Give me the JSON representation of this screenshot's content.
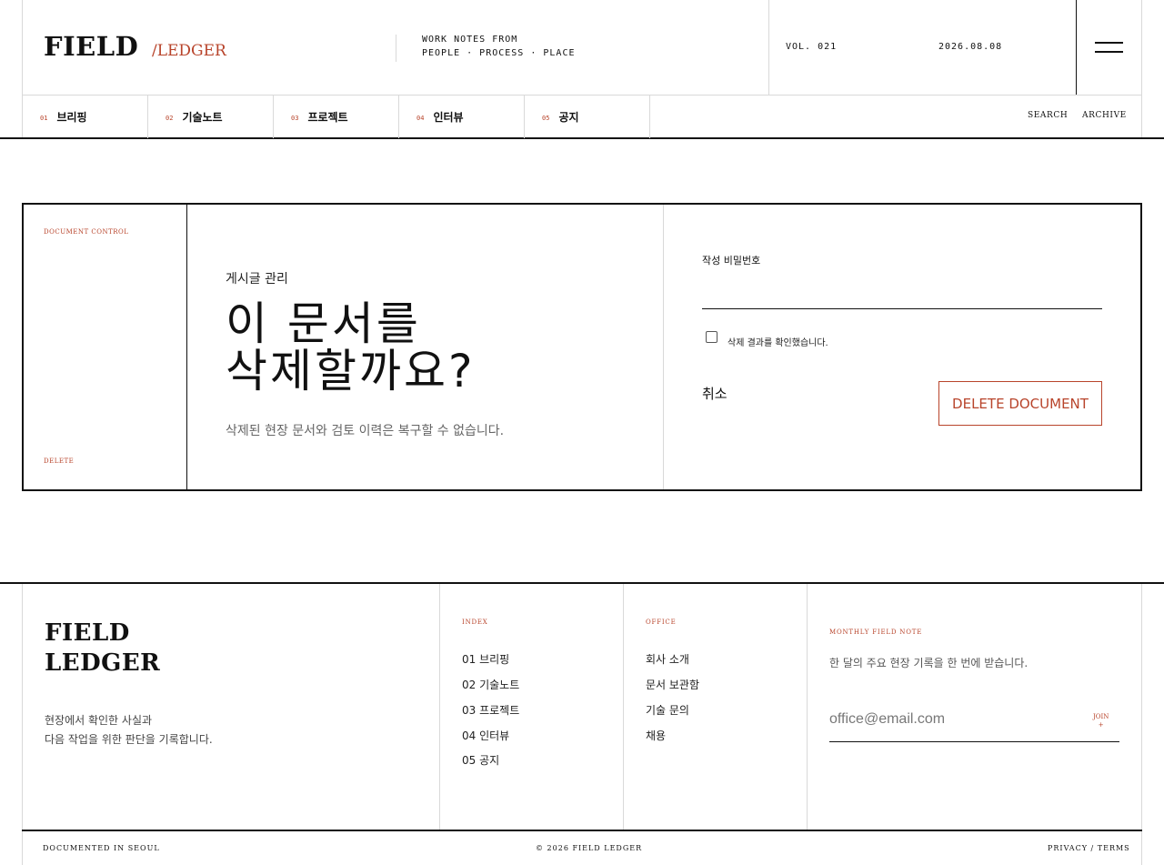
{
  "header": {
    "logo_main": "FIELD",
    "logo_sub": "/LEDGER",
    "tagline_1": "WORK NOTES FROM",
    "tagline_2": "PEOPLE · PROCESS · PLACE",
    "volume": "VOL. 021",
    "date": "2026.08.08"
  },
  "nav": {
    "items": [
      {
        "num": "01",
        "label": "브리핑"
      },
      {
        "num": "02",
        "label": "기술노트"
      },
      {
        "num": "03",
        "label": "프로젝트"
      },
      {
        "num": "04",
        "label": "인터뷰"
      },
      {
        "num": "05",
        "label": "공지"
      }
    ],
    "search": "SEARCH",
    "archive": "ARCHIVE"
  },
  "card": {
    "side_top": "DOCUMENT CONTROL",
    "side_bottom": "DELETE",
    "kicker": "게시글 관리",
    "title_line1": "이 문서를",
    "title_line2": "삭제할까요?",
    "description": "삭제된 현장 문서와 검토 이력은 복구할 수 없습니다.",
    "password_label": "작성 비밀번호",
    "password_value": "",
    "confirm_label": "삭제 결과를 확인했습니다.",
    "cancel_label": "취소",
    "delete_label": "DELETE DOCUMENT"
  },
  "footer": {
    "brand_line1": "FIELD",
    "brand_line2": "LEDGER",
    "desc_line1": "현장에서 확인한 사실과",
    "desc_line2": "다음 작업을 위한 판단을 기록합니다.",
    "index_head": "INDEX",
    "index_links": [
      "01 브리핑",
      "02 기술노트",
      "03 프로젝트",
      "04 인터뷰",
      "05 공지"
    ],
    "office_head": "OFFICE",
    "office_links": [
      "회사 소개",
      "문서 보관함",
      "기술 문의",
      "채용"
    ],
    "newsletter_head": "MONTHLY FIELD NOTE",
    "newsletter_desc": "한 달의 주요 현장 기록을 한 번에 받습니다.",
    "email_placeholder": "office@email.com",
    "join_label": "JOIN",
    "join_plus": "+",
    "bottom_left": "DOCUMENTED IN SEOUL",
    "bottom_center": "© 2026 FIELD LEDGER",
    "bottom_right": "PRIVACY / TERMS"
  },
  "colors": {
    "accent": "#b8442b",
    "ink": "#111111",
    "rule": "#d9d9d9"
  }
}
